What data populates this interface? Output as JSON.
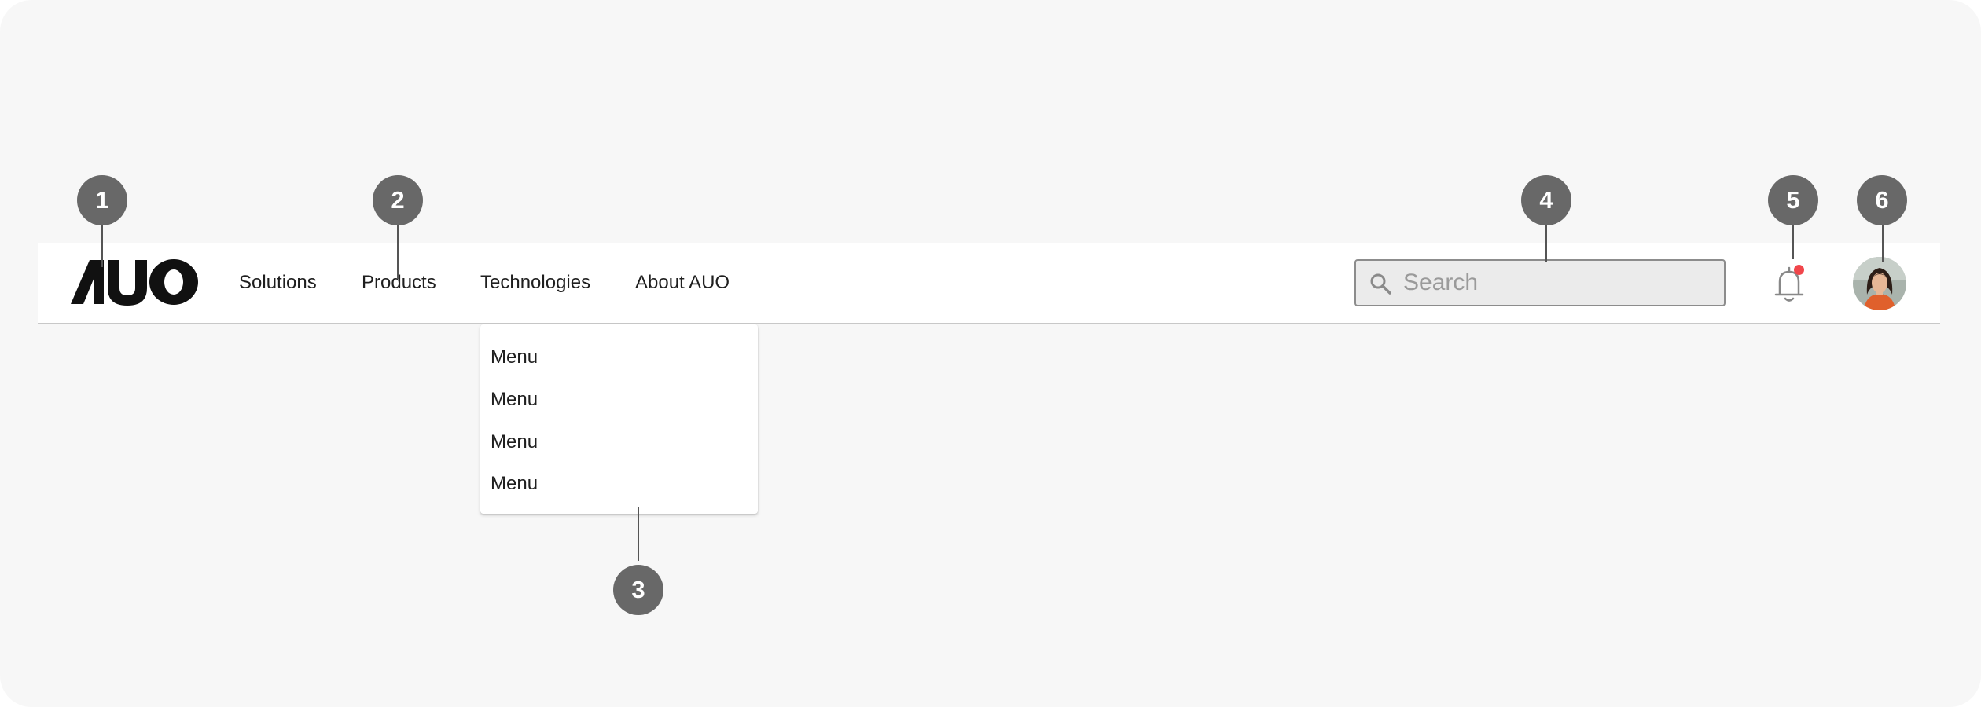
{
  "header": {
    "logo_text": "AUO",
    "nav": [
      {
        "label": "Solutions"
      },
      {
        "label": "Products"
      },
      {
        "label": "Technologies"
      },
      {
        "label": "About AUO"
      }
    ],
    "search": {
      "placeholder": "Search",
      "icon": "search-icon"
    },
    "notifications": {
      "icon": "bell-icon",
      "has_unread": true,
      "dot_color": "#F1464B"
    },
    "avatar": {
      "icon": "user-avatar"
    }
  },
  "dropdown": {
    "items": [
      {
        "label": "Menu"
      },
      {
        "label": "Menu"
      },
      {
        "label": "Menu"
      },
      {
        "label": "Menu"
      }
    ]
  },
  "callouts": [
    "1",
    "2",
    "3",
    "4",
    "5",
    "6"
  ],
  "colors": {
    "background": "#F7F7F7",
    "navbar": "#FFFFFF",
    "badge": "#686868",
    "search_bg": "#EBEBEB",
    "search_border": "#8C8C8C",
    "notification_dot": "#F1464B"
  }
}
